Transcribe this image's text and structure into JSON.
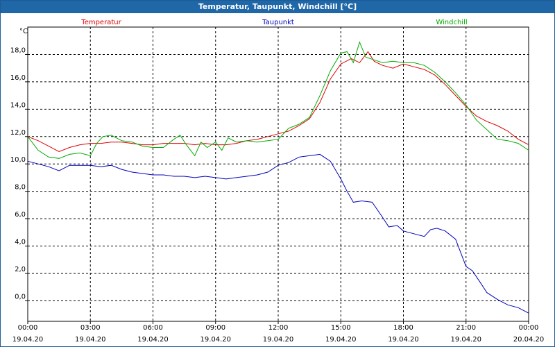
{
  "window": {
    "title": "Temperatur, Taupunkt, Windchill [°C]"
  },
  "colors": {
    "temperature": "#dd0000",
    "dewpoint": "#0000bb",
    "windchill": "#00aa00",
    "grid": "#000000",
    "title_bar": "#2067a8"
  },
  "chart_data": {
    "type": "line",
    "title": "Temperatur, Taupunkt, Windchill [°C]",
    "ylabel": "°C",
    "xlabel": "",
    "ylim": [
      -1.5,
      20
    ],
    "xlim": [
      0,
      24
    ],
    "grid": true,
    "legend_position": "top",
    "y_ticks": [
      "0,0",
      "2,0",
      "4,0",
      "6,0",
      "8,0",
      "10,0",
      "12,0",
      "14,0",
      "16,0",
      "18,0"
    ],
    "x_ticks": [
      {
        "time": "00:00",
        "date": "19.04.20"
      },
      {
        "time": "03:00",
        "date": "19.04.20"
      },
      {
        "time": "06:00",
        "date": "19.04.20"
      },
      {
        "time": "09:00",
        "date": "19.04.20"
      },
      {
        "time": "12:00",
        "date": "19.04.20"
      },
      {
        "time": "15:00",
        "date": "19.04.20"
      },
      {
        "time": "18:00",
        "date": "19.04.20"
      },
      {
        "time": "21:00",
        "date": "19.04.20"
      },
      {
        "time": "00:00",
        "date": "20.04.20"
      }
    ],
    "series": [
      {
        "name": "Temperatur",
        "color": "#dd0000",
        "x": [
          0,
          0.5,
          1,
          1.5,
          2,
          2.5,
          3,
          3.5,
          4,
          4.5,
          5,
          5.5,
          6,
          6.5,
          7,
          7.5,
          8,
          8.5,
          9,
          9.5,
          10,
          10.5,
          11,
          11.5,
          12,
          12.5,
          13,
          13.5,
          14,
          14.5,
          15,
          15.5,
          15.9,
          16.3,
          16.6,
          17,
          17.5,
          18,
          18.5,
          19,
          19.5,
          20,
          20.5,
          21,
          21.5,
          22,
          22.5,
          23,
          23.5,
          24
        ],
        "y": [
          12.0,
          11.7,
          11.3,
          10.9,
          11.2,
          11.4,
          11.5,
          11.5,
          11.6,
          11.6,
          11.5,
          11.4,
          11.4,
          11.5,
          11.5,
          11.5,
          11.4,
          11.5,
          11.4,
          11.4,
          11.5,
          11.7,
          11.8,
          12.0,
          12.2,
          12.4,
          12.8,
          13.3,
          14.5,
          16.2,
          17.3,
          17.7,
          17.4,
          18.2,
          17.5,
          17.2,
          17.0,
          17.3,
          17.1,
          16.9,
          16.5,
          15.8,
          15.0,
          14.2,
          13.5,
          13.1,
          12.8,
          12.4,
          11.8,
          11.4
        ]
      },
      {
        "name": "Taupunkt",
        "color": "#0000bb",
        "x": [
          0,
          0.5,
          1,
          1.5,
          2,
          2.5,
          3,
          3.5,
          4,
          4.5,
          5,
          5.5,
          6,
          6.5,
          7,
          7.5,
          8,
          8.5,
          9,
          9.5,
          10,
          10.5,
          11,
          11.5,
          12,
          12.5,
          13,
          13.5,
          14,
          14.5,
          15,
          15.3,
          15.6,
          16,
          16.5,
          17,
          17.3,
          17.7,
          18,
          18.5,
          19,
          19.3,
          19.6,
          20,
          20.5,
          21,
          21.3,
          21.7,
          22,
          22.5,
          23,
          23.5,
          24
        ],
        "y": [
          10.2,
          10.0,
          9.8,
          9.5,
          9.9,
          9.9,
          9.9,
          9.8,
          9.9,
          9.6,
          9.4,
          9.3,
          9.2,
          9.2,
          9.1,
          9.1,
          9.0,
          9.1,
          9.0,
          8.9,
          9.0,
          9.1,
          9.2,
          9.4,
          9.9,
          10.1,
          10.5,
          10.6,
          10.7,
          10.2,
          8.9,
          8.0,
          7.2,
          7.3,
          7.2,
          6.1,
          5.4,
          5.5,
          5.1,
          4.9,
          4.7,
          5.2,
          5.3,
          5.1,
          4.5,
          2.5,
          2.2,
          1.3,
          0.6,
          0.1,
          -0.3,
          -0.5,
          -0.9
        ]
      },
      {
        "name": "Windchill",
        "color": "#00aa00",
        "x": [
          0,
          0.5,
          1,
          1.5,
          2,
          2.5,
          3,
          3.3,
          3.6,
          4,
          4.5,
          5,
          5.5,
          6,
          6.5,
          7,
          7.3,
          7.6,
          8,
          8.3,
          8.6,
          9,
          9.3,
          9.6,
          10,
          10.5,
          11,
          11.5,
          12,
          12.5,
          13,
          13.5,
          14,
          14.5,
          15,
          15.3,
          15.6,
          15.9,
          16.2,
          16.6,
          17,
          17.5,
          18,
          18.5,
          19,
          19.5,
          20,
          20.5,
          21,
          21.5,
          22,
          22.5,
          23,
          23.5,
          24
        ],
        "y": [
          12.0,
          11.0,
          10.5,
          10.4,
          10.7,
          10.8,
          10.6,
          11.5,
          12.0,
          12.1,
          11.7,
          11.6,
          11.3,
          11.2,
          11.2,
          11.8,
          12.1,
          11.4,
          10.6,
          11.6,
          11.2,
          11.6,
          11.0,
          11.9,
          11.6,
          11.7,
          11.6,
          11.7,
          11.8,
          12.6,
          12.9,
          13.4,
          15.0,
          16.8,
          18.1,
          18.2,
          17.4,
          18.9,
          17.8,
          17.6,
          17.4,
          17.5,
          17.4,
          17.4,
          17.2,
          16.7,
          16.0,
          15.2,
          14.3,
          13.2,
          12.5,
          11.8,
          11.7,
          11.5,
          11.0
        ]
      }
    ]
  }
}
